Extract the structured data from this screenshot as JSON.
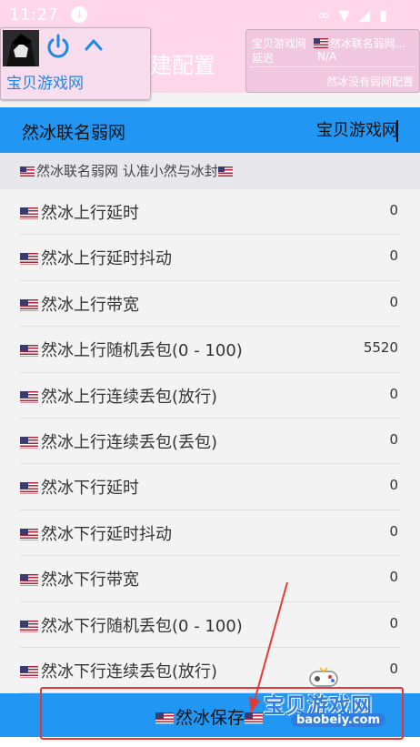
{
  "status_bar": {
    "time": "11:27"
  },
  "app_bar": {
    "title": "然冰新建配置"
  },
  "overlay": {
    "name": "宝贝游戏网"
  },
  "panel": {
    "label_game": "宝贝游戏网",
    "profile": "然冰联名弱网...",
    "label_delay": "延迟",
    "delay_value": "N/A",
    "footer": "然冰没有弱网配置"
  },
  "name_bar": {
    "label": "然冰联名弱网",
    "value": "宝贝游戏网"
  },
  "subheader": "然冰联名弱网 认准小然与冰封",
  "rows": [
    {
      "label": "然冰上行延时",
      "value": "0"
    },
    {
      "label": "然冰上行延时抖动",
      "value": "0"
    },
    {
      "label": "然冰上行带宽",
      "value": "0"
    },
    {
      "label": "然冰上行随机丢包(0 - 100)",
      "value": "5520"
    },
    {
      "label": "然冰上行连续丢包(放行)",
      "value": "0"
    },
    {
      "label": "然冰上行连续丢包(丢包)",
      "value": "0"
    },
    {
      "label": "然冰下行延时",
      "value": "0"
    },
    {
      "label": "然冰下行延时抖动",
      "value": "0"
    },
    {
      "label": "然冰下行带宽",
      "value": "0"
    },
    {
      "label": "然冰下行随机丢包(0 - 100)",
      "value": "0"
    },
    {
      "label": "然冰下行连续丢包(放行)",
      "value": "0"
    }
  ],
  "save_button": {
    "label": "然冰保存"
  },
  "watermark": {
    "title": "宝贝游戏网",
    "url": "baobeiy.com"
  },
  "colors": {
    "accent": "#2196f3",
    "pink": "#ffd6ea",
    "highlight": "#e53935"
  }
}
